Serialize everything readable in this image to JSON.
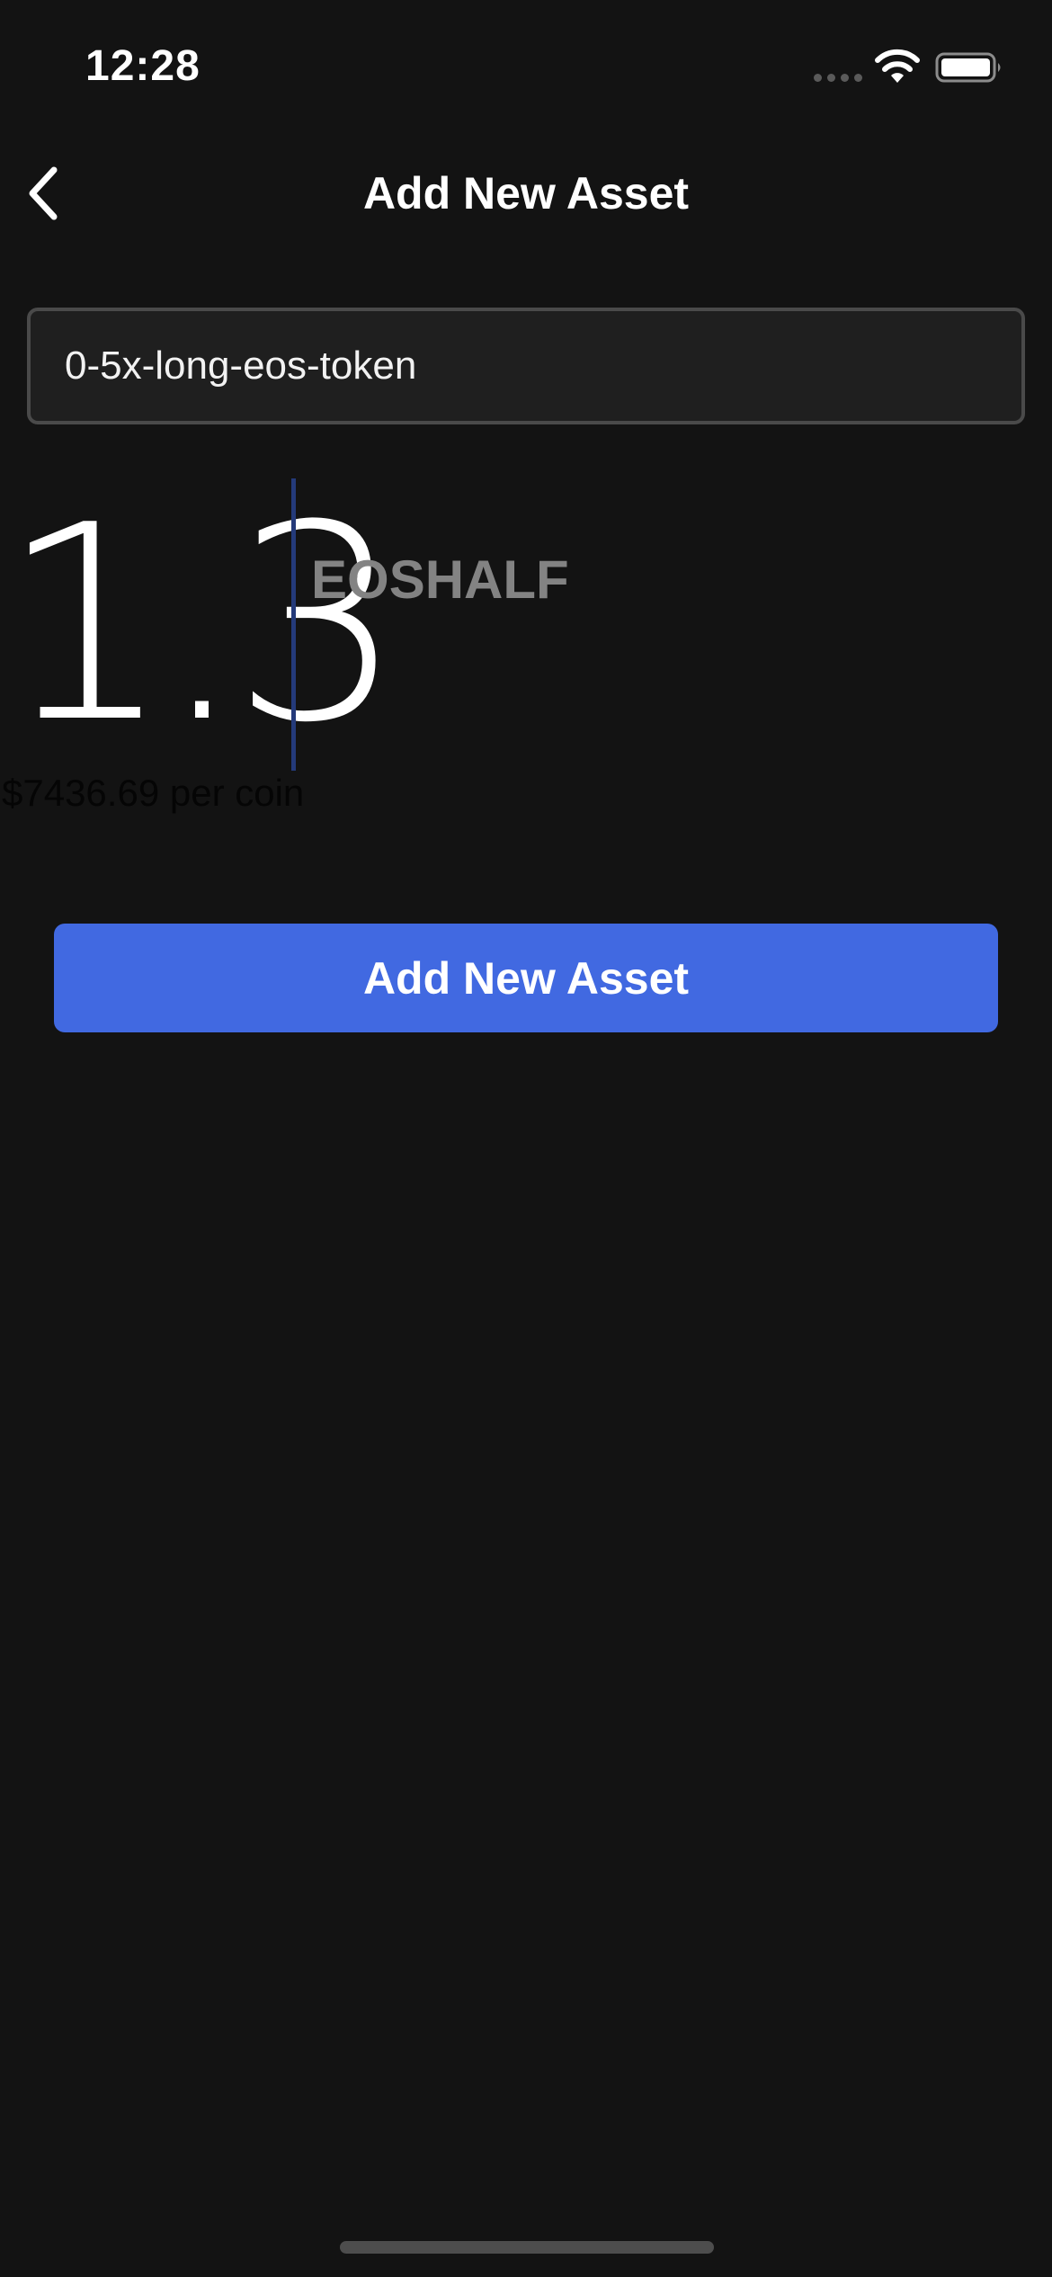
{
  "status_bar": {
    "time": "12:28"
  },
  "nav": {
    "title": "Add New Asset",
    "back_icon": "chevron-left-icon"
  },
  "token_input": {
    "value": "0-5x-long-eos-token"
  },
  "amount": {
    "value": "1.3",
    "symbol": "EOSHALF",
    "price_label": "$7436.69 per coin"
  },
  "actions": {
    "add_label": "Add New Asset"
  },
  "colors": {
    "background": "#131313",
    "input_bg": "#1f1f1f",
    "input_border": "#4a4a4a",
    "accent": "#4169e1",
    "cursor": "#243a7a",
    "symbol_text": "#838383"
  }
}
